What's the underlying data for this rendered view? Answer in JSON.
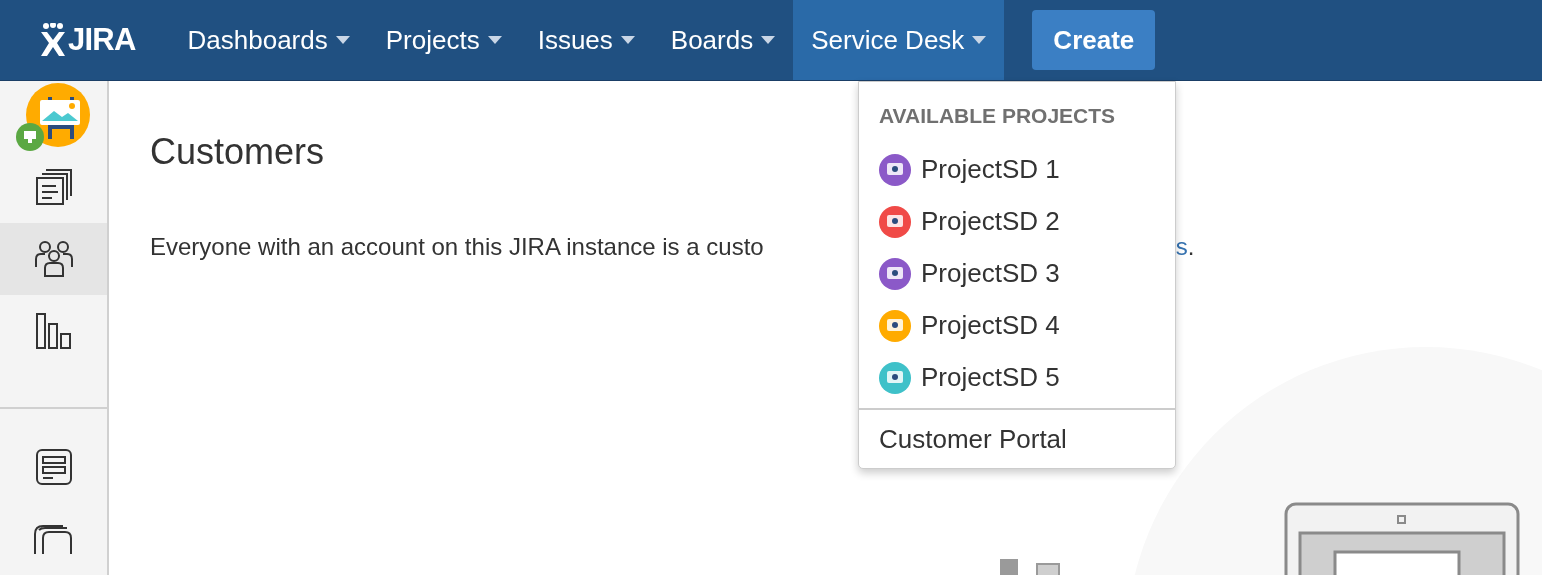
{
  "header": {
    "logo": "JIRA",
    "menus": [
      {
        "label": "Dashboards",
        "selected": false
      },
      {
        "label": "Projects",
        "selected": false
      },
      {
        "label": "Issues",
        "selected": false
      },
      {
        "label": "Boards",
        "selected": false
      },
      {
        "label": "Service Desk",
        "selected": true
      }
    ],
    "create_button": "Create"
  },
  "sidebar": {
    "items": [
      {
        "kind": "queues",
        "selected": false
      },
      {
        "kind": "customers",
        "selected": true
      },
      {
        "kind": "reports",
        "selected": false
      },
      {
        "kind": "divider"
      },
      {
        "kind": "channels",
        "selected": false
      },
      {
        "kind": "knowledge",
        "selected": false
      }
    ]
  },
  "page": {
    "title": "Customers",
    "text": "Everyone with an account on this JIRA instance is a custo",
    "link_tail": "s",
    "text_tail": "."
  },
  "dropdown": {
    "heading": "AVAILABLE PROJECTS",
    "projects": [
      {
        "name": "ProjectSD 1",
        "color": "#8b59c8"
      },
      {
        "name": "ProjectSD 2",
        "color": "#f04a47"
      },
      {
        "name": "ProjectSD 3",
        "color": "#8b59c8"
      },
      {
        "name": "ProjectSD 4",
        "color": "#ffab00"
      },
      {
        "name": "ProjectSD 5",
        "color": "#3fc1c9"
      }
    ],
    "footer_link": "Customer Portal"
  }
}
